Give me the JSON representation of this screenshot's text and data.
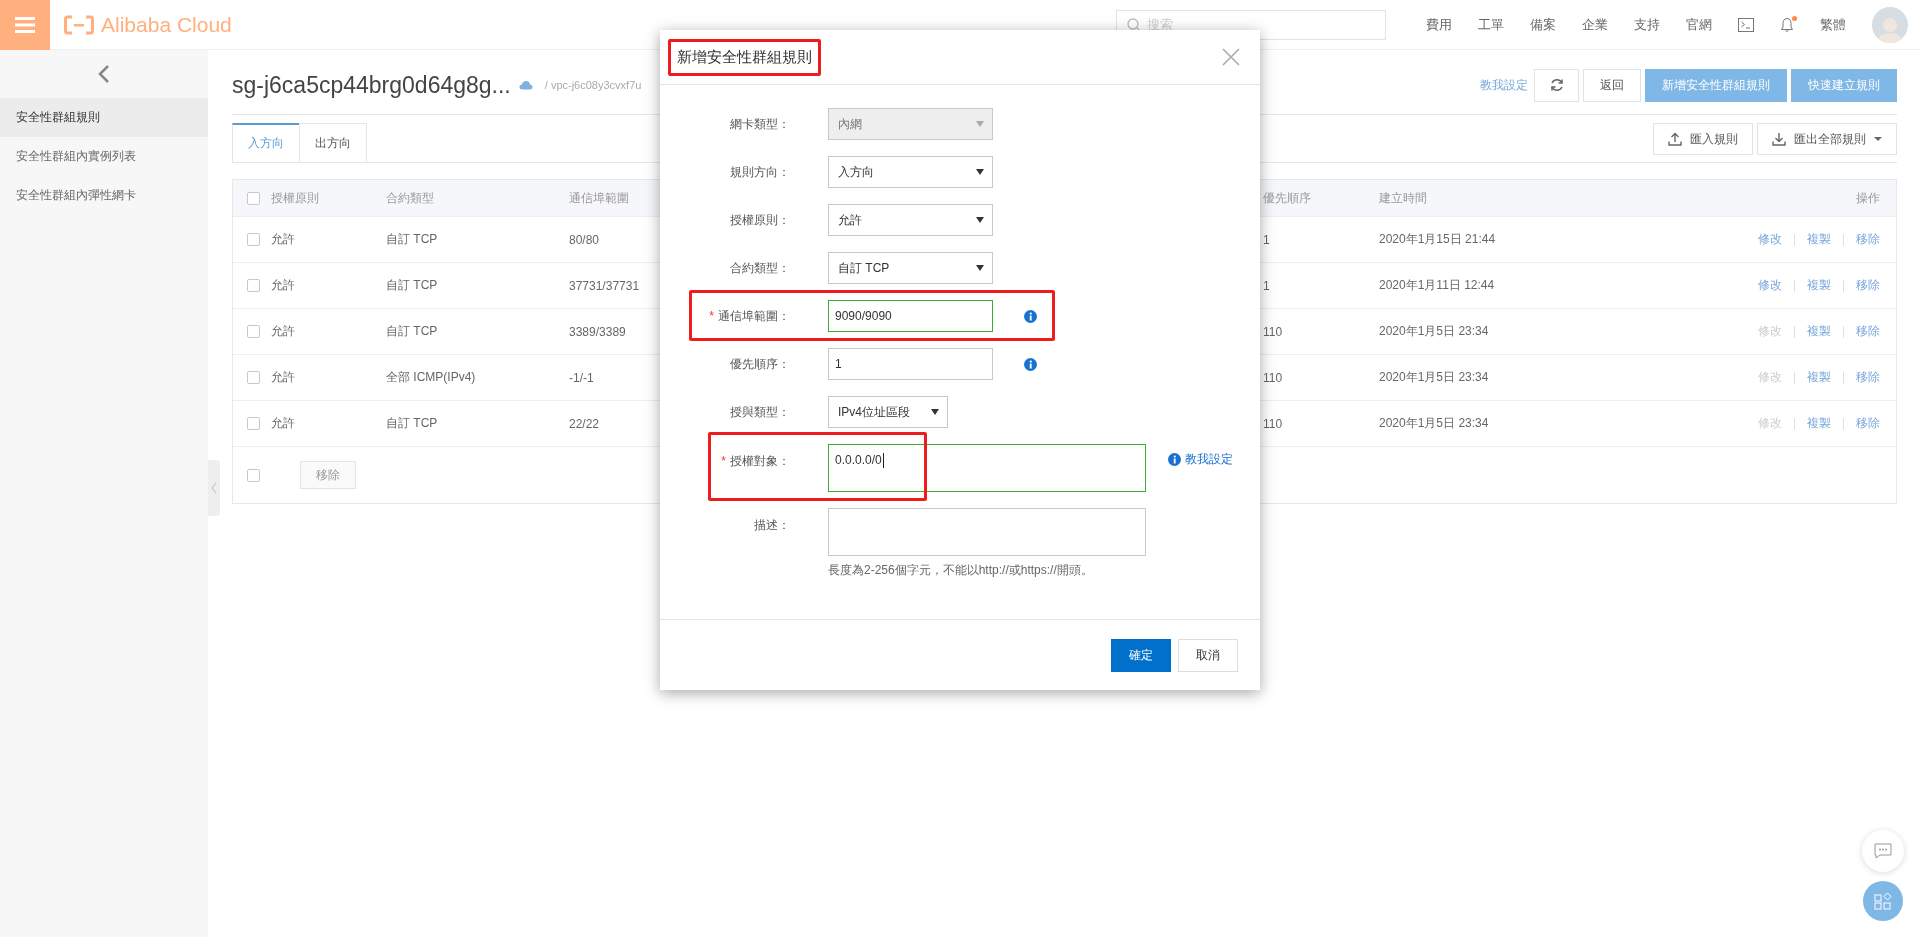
{
  "topbar": {
    "logo": "Alibaba Cloud",
    "search": {
      "placeholder": "搜索"
    },
    "nav": [
      "費用",
      "工單",
      "備案",
      "企業",
      "支持",
      "官網"
    ],
    "notification_dot": true,
    "language": "繁體"
  },
  "sidebar": {
    "items": [
      {
        "label": "安全性群組規則",
        "selected": true
      },
      {
        "label": "安全性群組內實例列表",
        "selected": false
      },
      {
        "label": "安全性群組內彈性網卡",
        "selected": false
      }
    ]
  },
  "header": {
    "title": "sg-j6ca5cp44brg0d64g8g...",
    "breadcrumb": "/ vpc-j6c08y3cvxf7u",
    "help_link": "教我設定",
    "buttons": [
      {
        "label": "返回",
        "kind": "default"
      },
      {
        "label": "新增安全性群組規則",
        "kind": "primary"
      },
      {
        "label": "快速建立規則",
        "kind": "primary"
      }
    ]
  },
  "tabs": [
    {
      "label": "入方向",
      "selected": true
    },
    {
      "label": "出方向",
      "selected": false
    }
  ],
  "tools": [
    {
      "label": "匯入規則",
      "kind": "import"
    },
    {
      "label": "匯出全部規則",
      "kind": "export"
    }
  ],
  "table": {
    "header_checked": false,
    "columns": [
      "授權原則",
      "合約類型",
      "通信埠範圍",
      "優先順序",
      "建立時間",
      "操作"
    ],
    "rows": [
      {
        "checked": false,
        "cells": [
          "允許",
          "自訂 TCP",
          "80/80",
          "1",
          "2020年1月15日 21:44"
        ],
        "actions": [
          {
            "label": "修改",
            "disabled": false
          },
          {
            "label": "複製",
            "disabled": false
          },
          {
            "label": "移除",
            "disabled": false
          }
        ]
      },
      {
        "checked": false,
        "cells": [
          "允許",
          "自訂 TCP",
          "37731/37731",
          "1",
          "2020年1月11日 12:44"
        ],
        "actions": [
          {
            "label": "修改",
            "disabled": false
          },
          {
            "label": "複製",
            "disabled": false
          },
          {
            "label": "移除",
            "disabled": false
          }
        ]
      },
      {
        "checked": false,
        "cells": [
          "允許",
          "自訂 TCP",
          "3389/3389",
          "110",
          "2020年1月5日 23:34"
        ],
        "actions": [
          {
            "label": "修改",
            "disabled": true
          },
          {
            "label": "複製",
            "disabled": false
          },
          {
            "label": "移除",
            "disabled": false
          }
        ]
      },
      {
        "checked": false,
        "cells": [
          "允許",
          "全部 ICMP(IPv4)",
          "-1/-1",
          "110",
          "2020年1月5日 23:34"
        ],
        "actions": [
          {
            "label": "修改",
            "disabled": true
          },
          {
            "label": "複製",
            "disabled": false
          },
          {
            "label": "移除",
            "disabled": false
          }
        ]
      },
      {
        "checked": false,
        "cells": [
          "允許",
          "自訂 TCP",
          "22/22",
          "110",
          "2020年1月5日 23:34"
        ],
        "actions": [
          {
            "label": "修改",
            "disabled": true
          },
          {
            "label": "複製",
            "disabled": false
          },
          {
            "label": "移除",
            "disabled": false
          }
        ]
      }
    ],
    "footer": {
      "checked": false,
      "button": "移除",
      "button_disabled": true
    }
  },
  "dialog": {
    "title": "新增安全性群組規則",
    "title_highlighted": true,
    "fields": [
      {
        "label": "網卡類型：",
        "kind": "select",
        "value": "內網",
        "disabled": true,
        "valid": false,
        "focused": false,
        "info": false,
        "highlighted": false
      },
      {
        "label": "規則方向：",
        "kind": "select",
        "value": "入方向",
        "disabled": false,
        "valid": false,
        "focused": false,
        "info": false,
        "highlighted": false
      },
      {
        "label": "授權原則：",
        "kind": "select",
        "value": "允許",
        "disabled": false,
        "valid": false,
        "focused": false,
        "info": false,
        "highlighted": false
      },
      {
        "label": "合約類型：",
        "kind": "select",
        "value": "自訂 TCP",
        "disabled": false,
        "valid": false,
        "focused": false,
        "info": false,
        "highlighted": false
      },
      {
        "label": "通信埠範圍：",
        "required_mark": "*",
        "kind": "input",
        "value": "9090/9090",
        "disabled": false,
        "valid": true,
        "focused": false,
        "info": true,
        "highlighted": true
      },
      {
        "label": "優先順序：",
        "kind": "input",
        "value": "1",
        "disabled": false,
        "valid": false,
        "focused": false,
        "info": true,
        "highlighted": false
      },
      {
        "label": "授與類型：",
        "kind": "shortselect",
        "value": "IPv4位址區段",
        "disabled": false,
        "valid": false,
        "focused": false,
        "info": false,
        "highlighted": false
      },
      {
        "label": "授權對象：",
        "required_mark": "*",
        "kind": "textarea",
        "value": "0.0.0.0/0",
        "disabled": false,
        "valid": true,
        "focused": true,
        "info": false,
        "link": "教我設定",
        "highlighted": true
      },
      {
        "label": "描述：",
        "kind": "textarea",
        "disabled": false,
        "valid": false,
        "focused": false,
        "info": false,
        "highlighted": false,
        "hint": "長度為2-256個字元，不能以http://或https://開頭。"
      }
    ],
    "buttons": [
      {
        "label": "確定",
        "kind": "primary"
      },
      {
        "label": "取消",
        "kind": "default"
      }
    ]
  }
}
